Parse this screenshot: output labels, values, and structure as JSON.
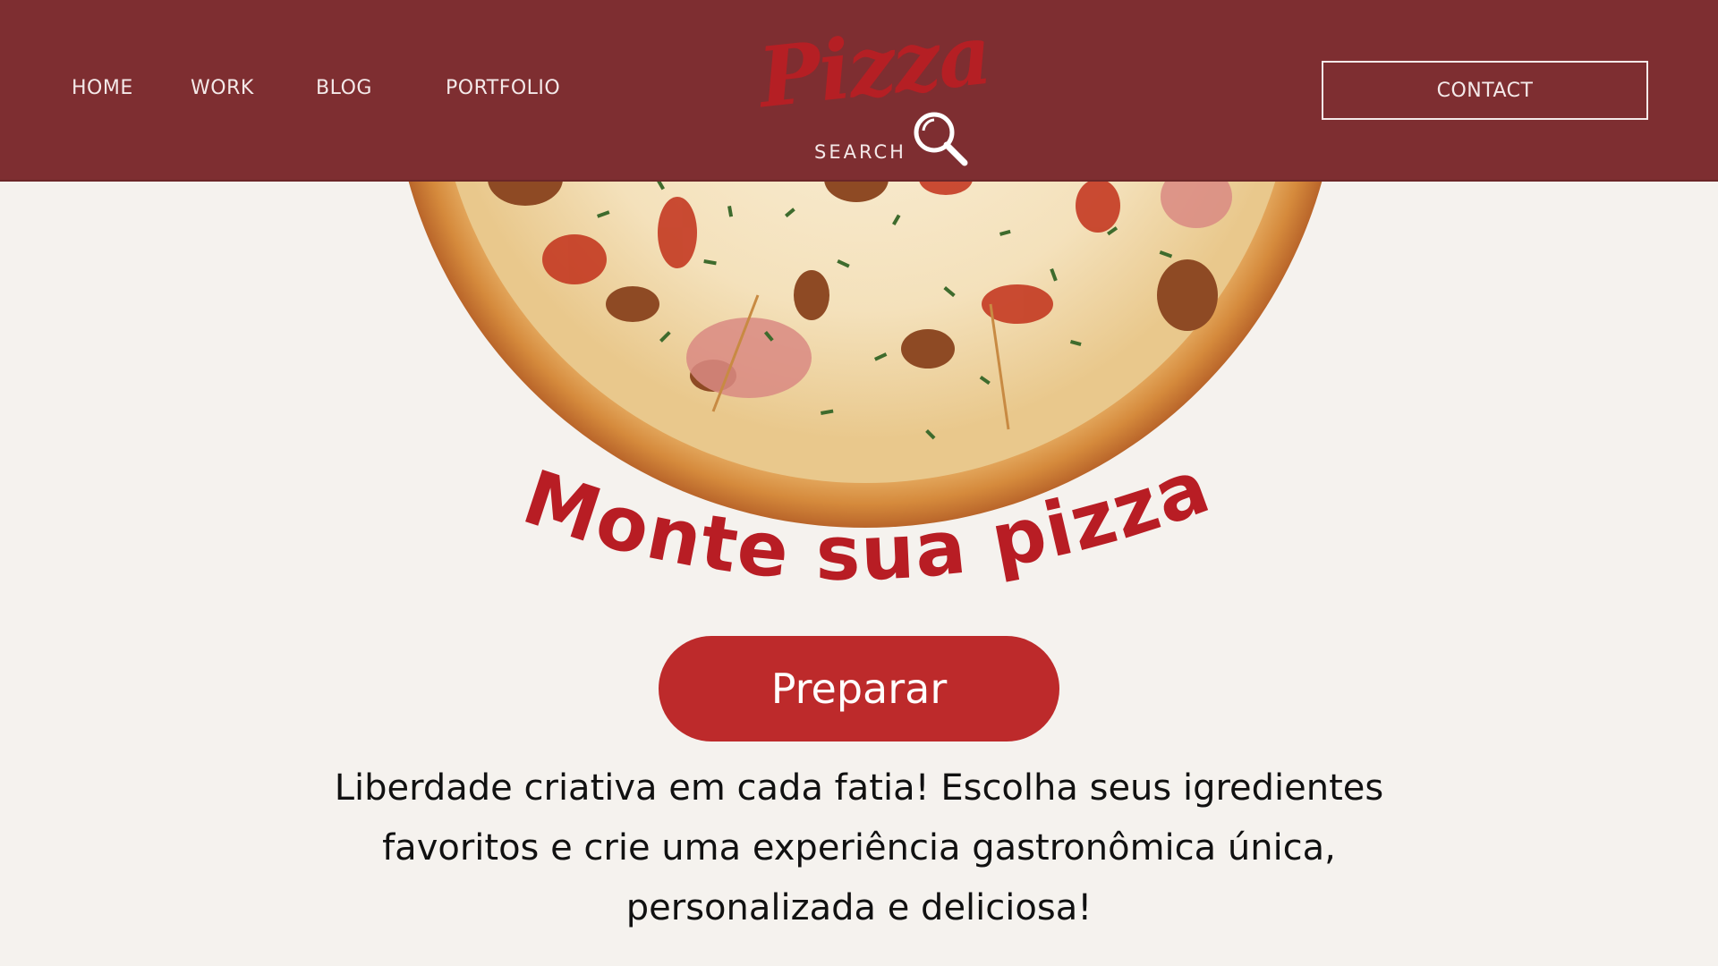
{
  "nav": {
    "items": [
      {
        "label": "HOME"
      },
      {
        "label": "WORK"
      },
      {
        "label": "BLOG"
      },
      {
        "label": "PORTFOLIO"
      }
    ],
    "contact_label": "CONTACT"
  },
  "logo": {
    "script_text": "Pizza",
    "subtitle": "SEARCH",
    "icon": "magnifier-icon"
  },
  "hero": {
    "headline": "Monte sua pizza!",
    "cta_label": "Preparar",
    "description": "Liberdade criativa em cada fatia! Escolha seus igredientes favoritos e crie uma experiência gastronômica única, personalizada e deliciosa!"
  },
  "colors": {
    "header_bg": "#7e2e31",
    "page_bg": "#f5f2ee",
    "accent_red": "#bd2a2b",
    "logo_red": "#b51f24",
    "headline_red": "#b81d24"
  }
}
